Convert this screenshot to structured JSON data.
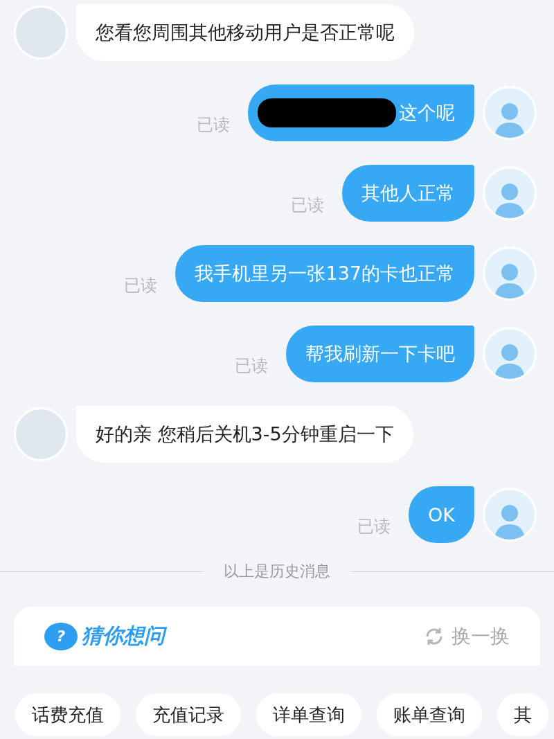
{
  "messages": [
    {
      "kind": "bot",
      "text": "您看您周围其他移动用户是否正常呢"
    },
    {
      "kind": "user",
      "text": "这个呢",
      "status": "已读",
      "redacted": true
    },
    {
      "kind": "user",
      "text": "其他人正常",
      "status": "已读",
      "redacted": false
    },
    {
      "kind": "user",
      "text": "我手机里另一张137的卡也正常",
      "status": "已读",
      "redacted": false
    },
    {
      "kind": "user",
      "text": "帮我刷新一下卡吧",
      "status": "已读",
      "redacted": false
    },
    {
      "kind": "bot",
      "text": "好的亲 您稍后关机3-5分钟重启一下"
    },
    {
      "kind": "user",
      "text": "OK",
      "status": "已读",
      "redacted": false
    }
  ],
  "history_divider": "以上是历史消息",
  "suggest_card": {
    "icon_char": "?",
    "title": "猜你想问",
    "refresh": "换一换"
  },
  "quick_actions": [
    "话费充值",
    "充值记录",
    "详单查询",
    "账单查询",
    "其"
  ]
}
